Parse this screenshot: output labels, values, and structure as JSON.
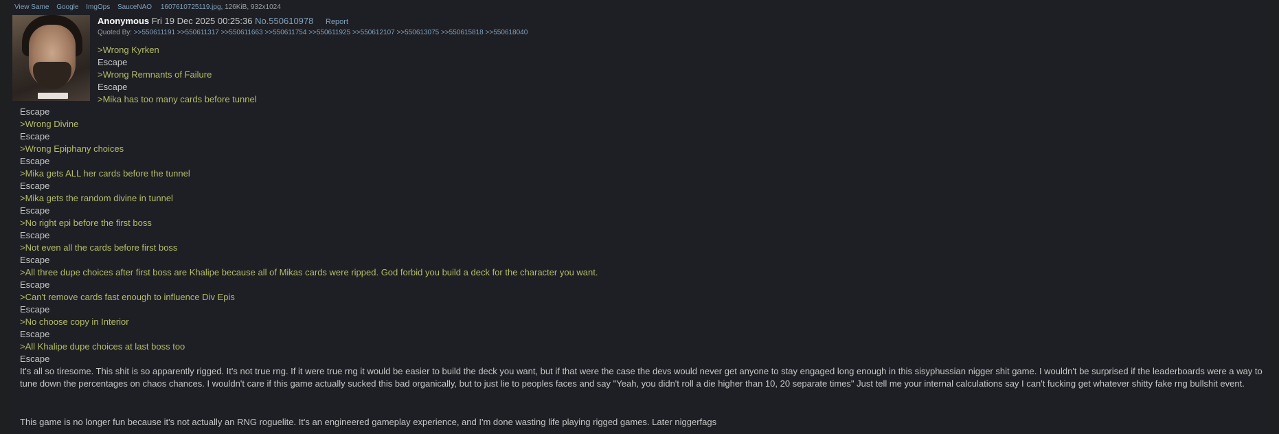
{
  "file": {
    "links": [
      "View Same",
      "Google",
      "ImgOps",
      "SauceNAO"
    ],
    "filename": "1607610725119.jpg",
    "meta": ", 126KiB, 932x1024"
  },
  "post": {
    "name": "Anonymous",
    "date": " Fri 19 Dec 2025 00:25:36 ",
    "number": "No.550610978",
    "report": "Report",
    "quoted_label": "Quoted By: ",
    "quoted_by": [
      ">>550611191",
      ">>550611317",
      ">>550611663",
      ">>550611754",
      ">>550611925",
      ">>550612107",
      ">>550613075",
      ">>550615818",
      ">>550618040"
    ]
  },
  "body": [
    {
      "t": ">Wrong Kyrken",
      "g": true
    },
    {
      "t": "Escape",
      "g": false
    },
    {
      "t": ">Wrong Remnants of Failure",
      "g": true
    },
    {
      "t": "Escape",
      "g": false
    },
    {
      "t": ">Mika has too many cards before tunnel",
      "g": true
    },
    {
      "t": "Escape",
      "g": false
    },
    {
      "t": ">Wrong Divine",
      "g": true
    },
    {
      "t": "Escape",
      "g": false
    },
    {
      "t": ">Wrong Epiphany choices",
      "g": true
    },
    {
      "t": "Escape",
      "g": false
    },
    {
      "t": ">Mika gets ALL her cards before the tunnel",
      "g": true
    },
    {
      "t": "Escape",
      "g": false
    },
    {
      "t": ">Mika gets the random divine in tunnel",
      "g": true
    },
    {
      "t": "Escape",
      "g": false
    },
    {
      "t": ">No right epi before the first boss",
      "g": true
    },
    {
      "t": "Escape",
      "g": false
    },
    {
      "t": ">Not even all the cards before first boss",
      "g": true
    },
    {
      "t": "Escape",
      "g": false
    },
    {
      "t": ">All three dupe choices after first boss are Khalipe because all of Mikas cards were ripped. God forbid you build a deck for the character you want.",
      "g": true
    },
    {
      "t": "Escape",
      "g": false
    },
    {
      "t": ">Can't remove cards fast enough to influence Div Epis",
      "g": true
    },
    {
      "t": "Escape",
      "g": false
    },
    {
      "t": ">No choose copy in Interior",
      "g": true
    },
    {
      "t": "Escape",
      "g": false
    },
    {
      "t": ">All Khalipe dupe choices at last boss too",
      "g": true
    },
    {
      "t": "Escape",
      "g": false
    }
  ],
  "paragraph1": "It's all so tiresome. This shit is so apparently rigged. It's not true rng. If it were true rng it would be easier to build the deck you want, but if that were the case the devs would never get anyone to stay engaged long enough in this sisyphussian nigger shit game. I wouldn't be surprised if the leaderboards were a way to tune down the percentages on chaos chances. I wouldn't care if this game actually sucked this bad organically, but to just lie to peoples faces and say \"Yeah, you didn't roll a die higher than 10, 20 separate times\" Just tell me your internal calculations say I can't fucking get whatever shitty fake rng bullshit event.",
  "paragraph2": "This game is no longer fun because it's not actually an RNG roguelite. It's an engineered gameplay experience, and I'm done wasting life playing rigged games. Later niggerfags"
}
